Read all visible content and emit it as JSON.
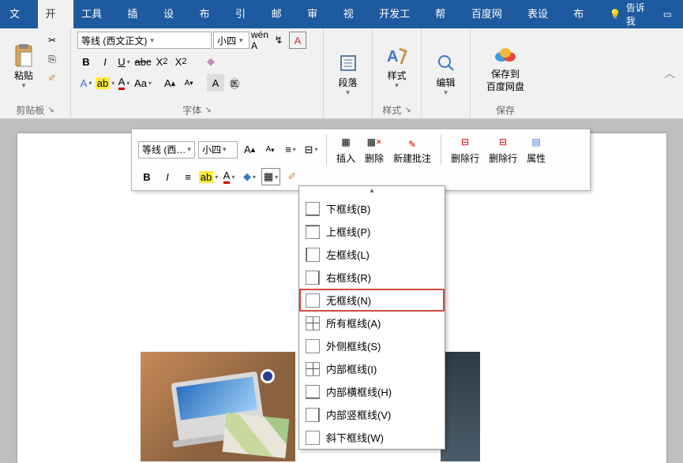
{
  "menubar": {
    "items": [
      "文件",
      "开始",
      "工具箱",
      "插入",
      "设计",
      "布局",
      "引用",
      "邮件",
      "审阅",
      "视图",
      "开发工具",
      "帮助",
      "百度网盘",
      "表设计",
      "布局"
    ],
    "active": "开始",
    "tellme": "告诉我"
  },
  "ribbon": {
    "clipboard": {
      "paste": "粘贴",
      "group": "剪贴板"
    },
    "font": {
      "name": "等线 (西文正文)",
      "size": "小四",
      "group": "字体"
    },
    "paragraph": {
      "label": "段落"
    },
    "styles": {
      "label": "样式",
      "group": "样式"
    },
    "editing": {
      "label": "编辑"
    },
    "save": {
      "line1": "保存到",
      "line2": "百度网盘",
      "group": "保存"
    }
  },
  "mini": {
    "font": "等线 (西…",
    "size": "小四",
    "insert": "插入",
    "delete": "删除",
    "new_note": "新建批注",
    "del_row1": "删除行",
    "del_row2": "删除行",
    "props": "属性"
  },
  "dropdown": {
    "items": [
      {
        "label": "下框线(B)",
        "klass": "bd-b"
      },
      {
        "label": "上框线(P)",
        "klass": "bd-t"
      },
      {
        "label": "左框线(L)",
        "klass": "bd-l"
      },
      {
        "label": "右框线(R)",
        "klass": "bd-r"
      },
      {
        "label": "无框线(N)",
        "klass": "bd-none",
        "selected": true
      },
      {
        "label": "所有框线(A)",
        "klass": "bd-grid"
      },
      {
        "label": "外侧框线(S)",
        "klass": "bd-all"
      },
      {
        "label": "内部框线(I)",
        "klass": "bd-grid"
      },
      {
        "label": "内部横框线(H)",
        "klass": "bd-b"
      },
      {
        "label": "内部竖框线(V)",
        "klass": "bd-r"
      },
      {
        "label": "斜下框线(W)",
        "klass": "bd-none"
      }
    ]
  }
}
